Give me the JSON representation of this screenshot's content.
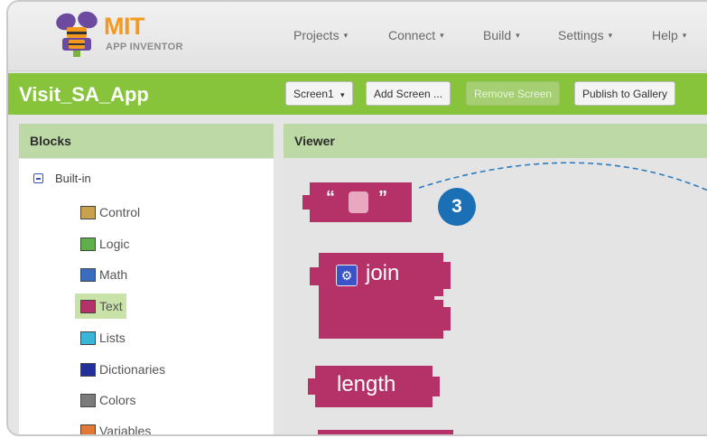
{
  "header": {
    "logo_title": "MIT",
    "logo_subtitle": "APP INVENTOR",
    "nav": [
      {
        "label": "Projects"
      },
      {
        "label": "Connect"
      },
      {
        "label": "Build"
      },
      {
        "label": "Settings"
      },
      {
        "label": "Help"
      }
    ],
    "caret": "▾"
  },
  "project_bar": {
    "project_name": "Visit_SA_App",
    "screen_select": "Screen1",
    "add_screen": "Add Screen ...",
    "remove_screen": "Remove Screen",
    "publish": "Publish to Gallery"
  },
  "blocks_panel": {
    "title": "Blocks",
    "group": "Built-in",
    "categories": [
      {
        "label": "Control",
        "color": "#c9a24f"
      },
      {
        "label": "Logic",
        "color": "#5fb04a"
      },
      {
        "label": "Math",
        "color": "#3a6cc0"
      },
      {
        "label": "Text",
        "color": "#b53269",
        "selected": true
      },
      {
        "label": "Lists",
        "color": "#3ab4d9"
      },
      {
        "label": "Dictionaries",
        "color": "#24309a"
      },
      {
        "label": "Colors",
        "color": "#7b7b7b"
      },
      {
        "label": "Variables",
        "color": "#e0783a"
      }
    ]
  },
  "viewer": {
    "title": "Viewer",
    "blocks": [
      {
        "name": "text-string",
        "open_quote": "“",
        "close_quote": "”"
      },
      {
        "name": "join",
        "label": "join"
      },
      {
        "name": "length",
        "label": "length"
      }
    ],
    "callout": "3"
  },
  "colors": {
    "accent_green": "#87c43c",
    "text_block": "#b53269",
    "callout_blue": "#1a6fb5"
  }
}
